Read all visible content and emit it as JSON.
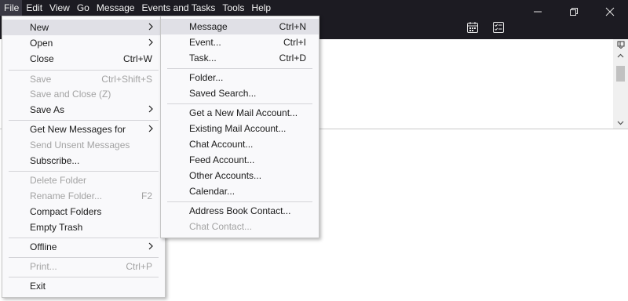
{
  "menubar": {
    "items": [
      {
        "label": "File"
      },
      {
        "label": "Edit"
      },
      {
        "label": "View"
      },
      {
        "label": "Go"
      },
      {
        "label": "Message"
      },
      {
        "label": "Events and Tasks"
      },
      {
        "label": "Tools"
      },
      {
        "label": "Help"
      }
    ]
  },
  "window_controls": {
    "minimize": "minimize-icon",
    "restore": "restore-icon",
    "close": "close-icon"
  },
  "toolbar": {
    "icons": [
      "calendar-icon",
      "tasks-icon"
    ]
  },
  "file_menu": {
    "items": [
      {
        "label": "New",
        "shortcut": "",
        "submenu": true,
        "disabled": false
      },
      {
        "label": "Open",
        "shortcut": "",
        "submenu": true,
        "disabled": false
      },
      {
        "label": "Close",
        "shortcut": "Ctrl+W",
        "submenu": false,
        "disabled": false
      },
      {
        "label": "Save",
        "shortcut": "Ctrl+Shift+S",
        "submenu": false,
        "disabled": true
      },
      {
        "label": "Save and Close (Z)",
        "shortcut": "",
        "submenu": false,
        "disabled": true
      },
      {
        "label": "Save As",
        "shortcut": "",
        "submenu": true,
        "disabled": false
      },
      {
        "label": "Get New Messages for",
        "shortcut": "",
        "submenu": true,
        "disabled": false
      },
      {
        "label": "Send Unsent Messages",
        "shortcut": "",
        "submenu": false,
        "disabled": true
      },
      {
        "label": "Subscribe...",
        "shortcut": "",
        "submenu": false,
        "disabled": false
      },
      {
        "label": "Delete Folder",
        "shortcut": "",
        "submenu": false,
        "disabled": true
      },
      {
        "label": "Rename Folder...",
        "shortcut": "F2",
        "submenu": false,
        "disabled": true
      },
      {
        "label": "Compact Folders",
        "shortcut": "",
        "submenu": false,
        "disabled": false
      },
      {
        "label": "Empty Trash",
        "shortcut": "",
        "submenu": false,
        "disabled": false
      },
      {
        "label": "Offline",
        "shortcut": "",
        "submenu": true,
        "disabled": false
      },
      {
        "label": "Print...",
        "shortcut": "Ctrl+P",
        "submenu": false,
        "disabled": true
      },
      {
        "label": "Exit",
        "shortcut": "",
        "submenu": false,
        "disabled": false
      }
    ]
  },
  "new_submenu": {
    "items": [
      {
        "label": "Message",
        "shortcut": "Ctrl+N",
        "disabled": false
      },
      {
        "label": "Event...",
        "shortcut": "Ctrl+I",
        "disabled": false
      },
      {
        "label": "Task...",
        "shortcut": "Ctrl+D",
        "disabled": false
      },
      {
        "label": "Folder...",
        "shortcut": "",
        "disabled": false
      },
      {
        "label": "Saved Search...",
        "shortcut": "",
        "disabled": false
      },
      {
        "label": "Get a New Mail Account...",
        "shortcut": "",
        "disabled": false
      },
      {
        "label": "Existing Mail Account...",
        "shortcut": "",
        "disabled": false
      },
      {
        "label": "Chat Account...",
        "shortcut": "",
        "disabled": false
      },
      {
        "label": "Feed Account...",
        "shortcut": "",
        "disabled": false
      },
      {
        "label": "Other Accounts...",
        "shortcut": "",
        "disabled": false
      },
      {
        "label": "Calendar...",
        "shortcut": "",
        "disabled": false
      },
      {
        "label": "Address Book Contact...",
        "shortcut": "",
        "disabled": false
      },
      {
        "label": "Chat Contact...",
        "shortcut": "",
        "disabled": true
      }
    ]
  }
}
